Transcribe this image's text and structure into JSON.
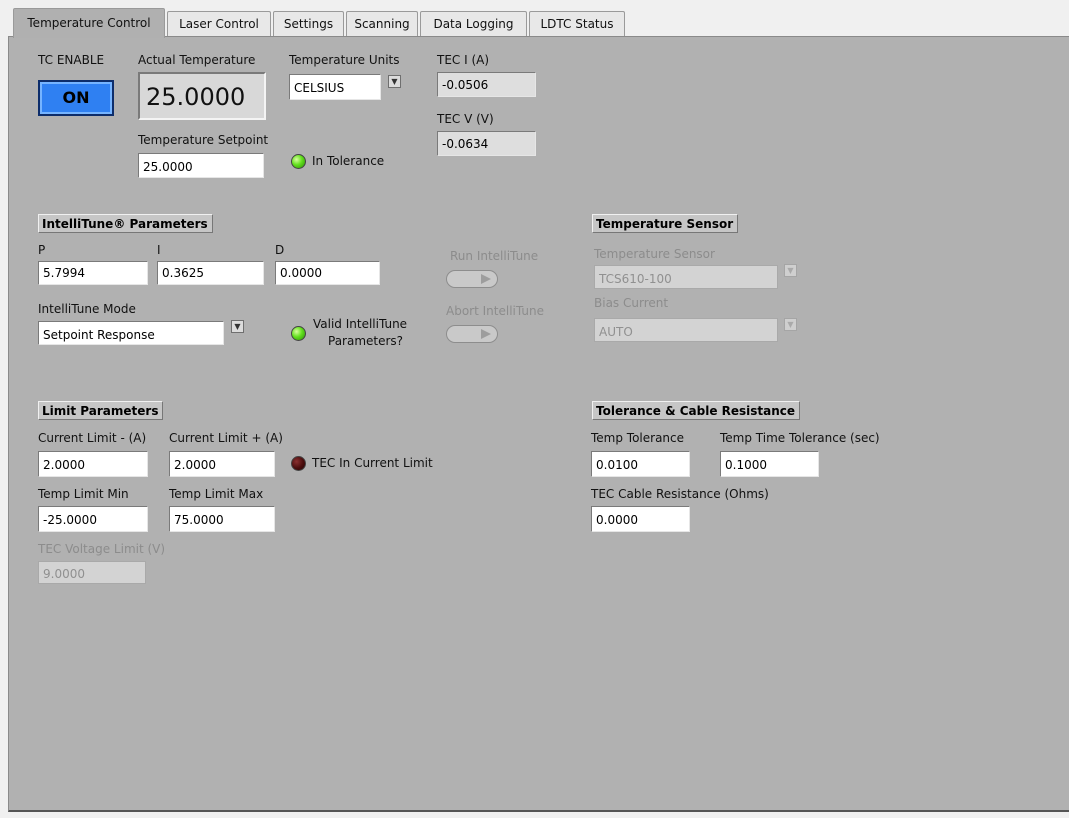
{
  "tabs": [
    "Temperature Control",
    "Laser Control",
    "Settings",
    "Scanning",
    "Data Logging",
    "LDTC Status"
  ],
  "tc_enable": {
    "label": "TC ENABLE",
    "button": "ON"
  },
  "actual_temperature": {
    "label": "Actual Temperature",
    "value": "25.0000"
  },
  "temperature_units": {
    "label": "Temperature Units",
    "value": "CELSIUS"
  },
  "tec_i": {
    "label": "TEC I (A)",
    "value": "-0.0506"
  },
  "tec_v": {
    "label": "TEC V (V)",
    "value": "-0.0634"
  },
  "setpoint": {
    "label": "Temperature Setpoint",
    "value": "25.0000"
  },
  "in_tolerance": {
    "label": "In Tolerance",
    "color": "#5cd91a"
  },
  "intellitune": {
    "section": "IntelliTune® Parameters",
    "p_label": "P",
    "p_value": "5.7994",
    "i_label": "I",
    "i_value": "0.3625",
    "d_label": "D",
    "d_value": "0.0000",
    "mode_label": "IntelliTune Mode",
    "mode_value": "Setpoint Response",
    "valid_label_1": "Valid IntelliTune",
    "valid_label_2": "Parameters?",
    "run_label": "Run IntelliTune",
    "abort_label": "Abort IntelliTune"
  },
  "temperature_sensor": {
    "section": "Temperature Sensor",
    "sensor_label": "Temperature Sensor",
    "sensor_value": "TCS610-100",
    "bias_label": "Bias Current",
    "bias_value": "AUTO"
  },
  "limits": {
    "section": "Limit Parameters",
    "cur_neg_label": "Current Limit - (A)",
    "cur_neg_value": "2.0000",
    "cur_pos_label": "Current Limit + (A)",
    "cur_pos_value": "2.0000",
    "tec_in_limit_label": "TEC In Current Limit",
    "tmin_label": "Temp Limit Min",
    "tmin_value": "-25.0000",
    "tmax_label": "Temp Limit Max",
    "tmax_value": "75.0000",
    "vlim_label": "TEC Voltage Limit (V)",
    "vlim_value": "9.0000"
  },
  "tolerance": {
    "section": "Tolerance & Cable Resistance",
    "temp_tol_label": "Temp Tolerance",
    "temp_tol_value": "0.0100",
    "time_tol_label": "Temp Time Tolerance (sec)",
    "time_tol_value": "0.1000",
    "cable_label": "TEC Cable Resistance (Ohms)",
    "cable_value": "0.0000"
  },
  "colors": {
    "panel": "#b1b1b1",
    "on_button": "#2f80f2"
  }
}
